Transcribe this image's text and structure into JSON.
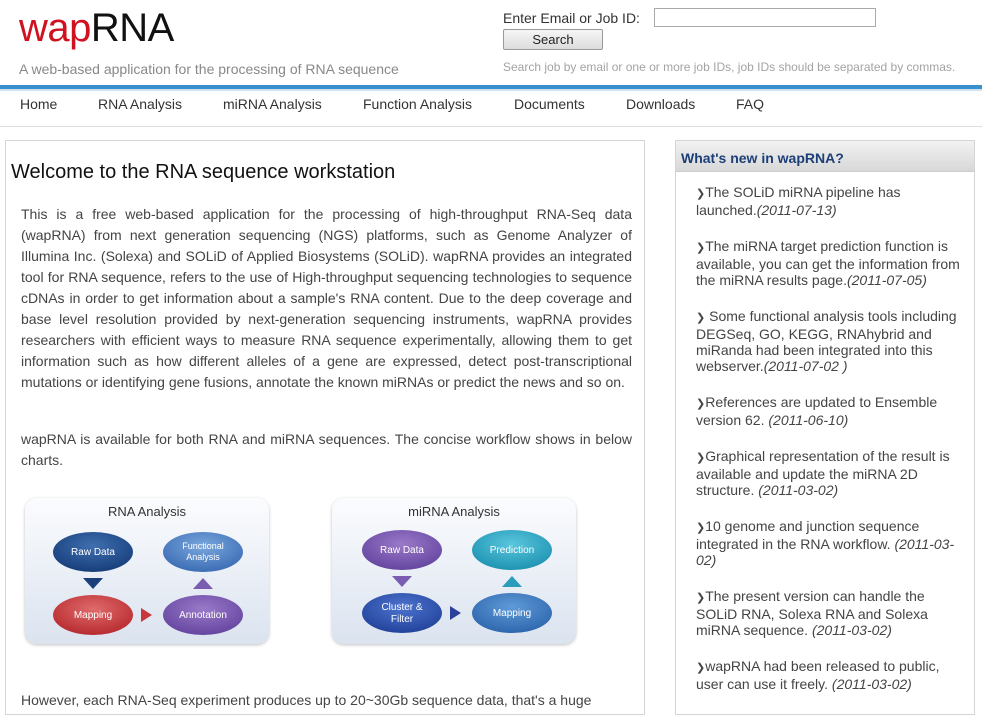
{
  "header": {
    "logo_part1": "wap",
    "logo_part2": "RNA",
    "tagline": "A web-based application for the processing of RNA sequence",
    "search_label": "Enter Email or Job ID:",
    "search_value": "",
    "search_button": "Search",
    "search_hint": "Search job by email or one or more job IDs, job IDs should be separated by commas.",
    "accent_color": "#3a8fcf",
    "logo_color": "#d0111f"
  },
  "nav": [
    "Home",
    "RNA Analysis",
    "miRNA Analysis",
    "Function Analysis",
    "Documents",
    "Downloads",
    "FAQ"
  ],
  "main": {
    "title": "Welcome to the RNA sequence workstation",
    "para1": "This is a free web-based application for the processing of high-throughput RNA-Seq data (wapRNA) from next generation sequencing (NGS) platforms, such as Genome Analyzer of Illumina Inc. (Solexa) and SOLiD of Applied Biosystems (SOLiD). wapRNA provides an integrated tool for RNA sequence, refers to the use of High-throughput sequencing technologies to sequence cDNAs in order to get information about a sample's RNA content. Due to the deep coverage and base level resolution provided by next-generation sequencing instruments, wapRNA provides researchers with efficient ways to measure RNA sequence experimentally, allowing them to get information such as how different alleles of a gene are expressed, detect post-transcriptional mutations or identifying gene fusions, annotate the known miRNAs or predict the news and so on.",
    "para2": "wapRNA is available for both RNA and miRNA sequences. The concise workflow shows in below charts.",
    "para3": "However, each RNA-Seq experiment produces up to 20~30Gb sequence data, that's a huge"
  },
  "diagrams": {
    "rna": {
      "title": "RNA  Analysis",
      "raw_data": "Raw Data",
      "functional_1": "Functional",
      "functional_2": "Analysis",
      "mapping": "Mapping",
      "annotation": "Annotation"
    },
    "mirna": {
      "title": "miRNA  Analysis",
      "raw_data": "Raw Data",
      "prediction": "Prediction",
      "cluster_1": "Cluster &",
      "cluster_2": "Filter",
      "mapping": "Mapping"
    }
  },
  "sidebar": {
    "title": "What's new in wapRNA?",
    "news": [
      {
        "text": "The SOLiD miRNA pipeline has launched.",
        "date": "(2011-07-13)"
      },
      {
        "text": "The miRNA target prediction function is available, you can get the information from the miRNA results page.",
        "date": "(2011-07-05)"
      },
      {
        "text": " Some functional analysis tools including DEGSeq, GO, KEGG, RNAhybrid and miRanda had been integrated into this webserver.",
        "date": "(2011-07-02 )"
      },
      {
        "text": "References are updated to Ensemble version 62. ",
        "date": "(2011-06-10)"
      },
      {
        "text": "Graphical representation of the result is available and update the miRNA 2D structure. ",
        "date": "(2011-03-02)"
      },
      {
        "text": "10 genome and junction sequence integrated in the RNA workflow. ",
        "date": "(2011-03-02)"
      },
      {
        "text": "The present version can handle the SOLiD RNA, Solexa RNA and Solexa miRNA sequence. ",
        "date": "(2011-03-02)"
      },
      {
        "text": "wapRNA had been released to public, user can use it freely. ",
        "date": "(2011-03-02)"
      }
    ]
  }
}
